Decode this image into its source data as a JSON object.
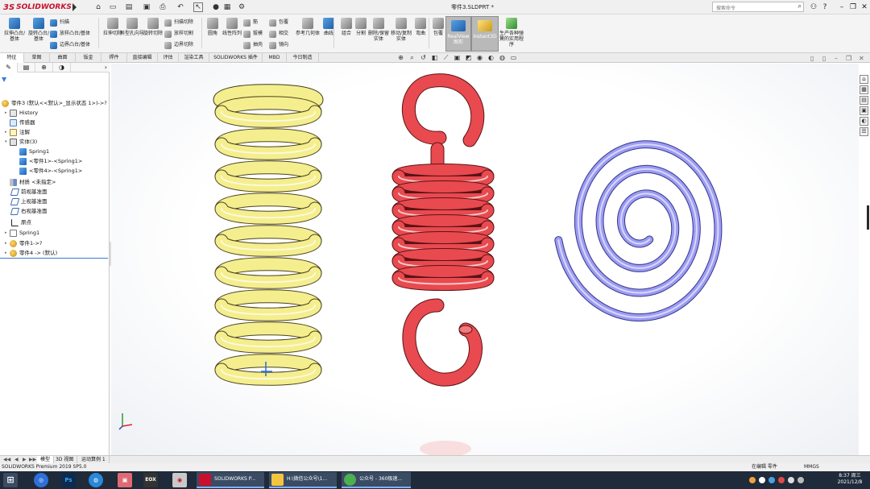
{
  "app": {
    "brand": "SOLIDWORKS",
    "brand_prefix": "3S",
    "doc_title": "零件3.SLDPRT *"
  },
  "search": {
    "placeholder": "搜索命令"
  },
  "ribbon": {
    "groups": [
      {
        "label": "拉伸凸台/基体"
      },
      {
        "label": "旋转凸台/基体"
      },
      {
        "label": "扫描"
      },
      {
        "label": "放样凸台/基体"
      },
      {
        "label": "边界凸台/基体"
      },
      {
        "label": "拉伸切除"
      },
      {
        "label": "异型孔向导"
      },
      {
        "label": "旋转切除"
      },
      {
        "label": "扫描切除"
      },
      {
        "label": "放样切割"
      },
      {
        "label": "边界切除"
      },
      {
        "label": "圆角"
      },
      {
        "label": "线性阵列"
      },
      {
        "label": "筋"
      },
      {
        "label": "拔模"
      },
      {
        "label": "抽壳"
      },
      {
        "label": "包覆"
      },
      {
        "label": "相交"
      },
      {
        "label": "镜向"
      },
      {
        "label": "参考几何体"
      },
      {
        "label": "曲线"
      },
      {
        "label": "组合"
      },
      {
        "label": "分割"
      },
      {
        "label": "删除/保留实体"
      },
      {
        "label": "移动/复制实体"
      },
      {
        "label": "弯曲"
      },
      {
        "label": "包覆"
      },
      {
        "label": "RealView 图形"
      },
      {
        "label": "Instant3D"
      },
      {
        "label": "生产各种弹簧的实用程序"
      }
    ]
  },
  "tabs": [
    "特征",
    "草图",
    "曲面",
    "钣金",
    "焊件",
    "直接编辑",
    "评估",
    "渲染工具",
    "SOLIDWORKS 插件",
    "MBD",
    "今日制造"
  ],
  "tree": {
    "root": "零件3 (默认<<默认>_显示状态 1>)->?",
    "items": [
      {
        "label": "History",
        "icon": "history"
      },
      {
        "label": "传感器",
        "icon": "sensor"
      },
      {
        "label": "注解",
        "icon": "annotation"
      },
      {
        "label": "实体(3)",
        "icon": "solid-bodies"
      },
      {
        "label": "Spring1",
        "icon": "body"
      },
      {
        "label": "<零件1>-<Spring1>",
        "icon": "body"
      },
      {
        "label": "<零件4>-<Spring1>",
        "icon": "body"
      },
      {
        "label": "材质 <未指定>",
        "icon": "material"
      },
      {
        "label": "前视基准面",
        "icon": "plane"
      },
      {
        "label": "上视基准面",
        "icon": "plane"
      },
      {
        "label": "右视基准面",
        "icon": "plane"
      },
      {
        "label": "原点",
        "icon": "origin"
      },
      {
        "label": "Spring1",
        "icon": "sketch"
      },
      {
        "label": "零件1->?",
        "icon": "part"
      },
      {
        "label": "零件4 -> (默认)",
        "icon": "part"
      }
    ]
  },
  "model_tabs": [
    "模型",
    "3D 视图",
    "运动算例 1"
  ],
  "status": {
    "left": "SOLIDWORKS Premium 2019 SP5.0",
    "mode": "在编辑 零件",
    "units": "MMGS"
  },
  "taskbar": {
    "windows": [
      "SOLIDWORKS P...",
      "H:\\微信公众号\\1...",
      "公众号 - 360极速..."
    ],
    "time": "8:37 周三",
    "date": "2021/12/8"
  },
  "colors": {
    "yellow_spring": "#f5ee8e",
    "red_spring": "#e84a4f",
    "blue_spring": "#9c9cf2",
    "brand": "#c8102e"
  }
}
